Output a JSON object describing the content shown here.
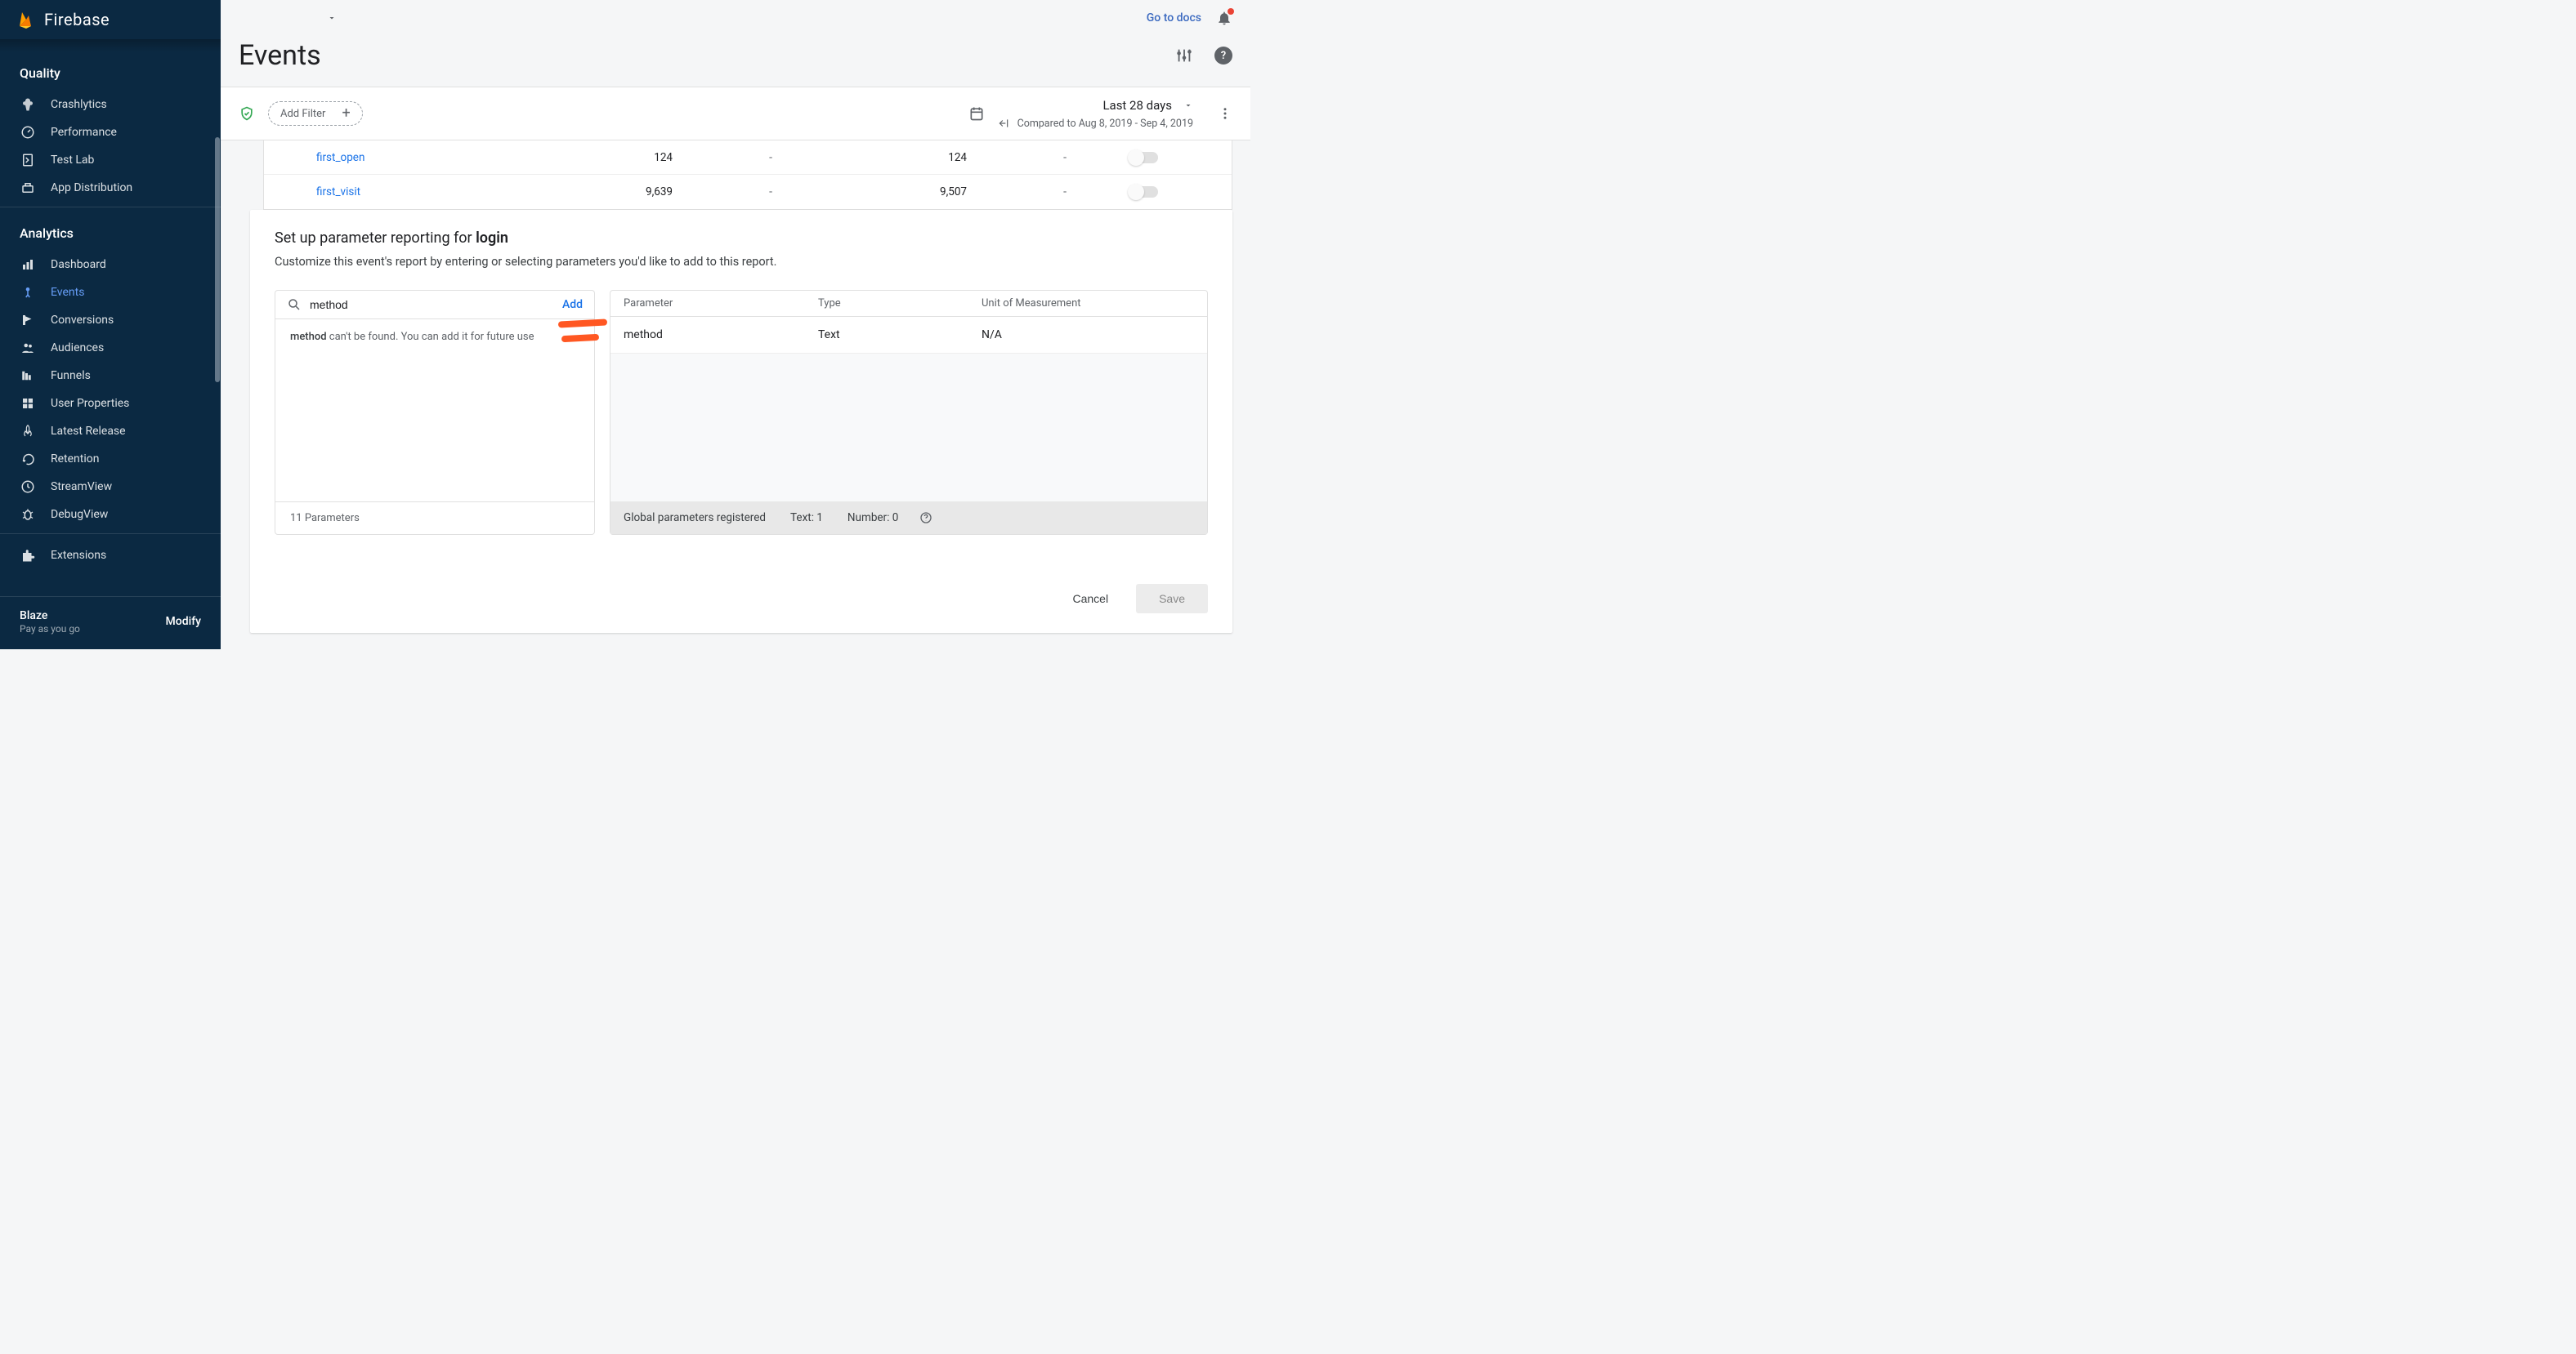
{
  "brand": "Firebase",
  "sidebar": {
    "section_quality": "Quality",
    "quality_items": [
      {
        "label": "Crashlytics"
      },
      {
        "label": "Performance"
      },
      {
        "label": "Test Lab"
      },
      {
        "label": "App Distribution"
      }
    ],
    "section_analytics": "Analytics",
    "analytics_items": [
      {
        "label": "Dashboard"
      },
      {
        "label": "Events"
      },
      {
        "label": "Conversions"
      },
      {
        "label": "Audiences"
      },
      {
        "label": "Funnels"
      },
      {
        "label": "User Properties"
      },
      {
        "label": "Latest Release"
      },
      {
        "label": "Retention"
      },
      {
        "label": "StreamView"
      },
      {
        "label": "DebugView"
      }
    ],
    "extensions": "Extensions",
    "plan": {
      "name": "Blaze",
      "sub": "Pay as you go",
      "modify": "Modify"
    }
  },
  "topbar": {
    "go_docs": "Go to docs"
  },
  "page": {
    "title": "Events"
  },
  "filter": {
    "add": "Add Filter",
    "date": "Last 28 days",
    "compare": "Compared to Aug 8, 2019 - Sep 4, 2019"
  },
  "events_rows": [
    {
      "name": "first_open",
      "count": "124",
      "users": "124"
    },
    {
      "name": "first_visit",
      "count": "9,639",
      "users": "9,507"
    }
  ],
  "panel": {
    "title_prefix": "Set up parameter reporting for ",
    "title_bold": "login",
    "desc": "Customize this event's report by entering or selecting parameters you'd like to add to this report.",
    "search": {
      "value": "method",
      "add": "Add",
      "msg_bold": "method",
      "msg_rest": " can't be found. You can add it for future use",
      "footer": "11 Parameters"
    },
    "headers": {
      "param": "Parameter",
      "type": "Type",
      "unit": "Unit of Measurement"
    },
    "row": {
      "param": "method",
      "type": "Text",
      "unit": "N/A"
    },
    "footer": {
      "reg": "Global parameters registered",
      "text": "Text: 1",
      "number": "Number: 0"
    },
    "cancel": "Cancel",
    "save": "Save"
  }
}
